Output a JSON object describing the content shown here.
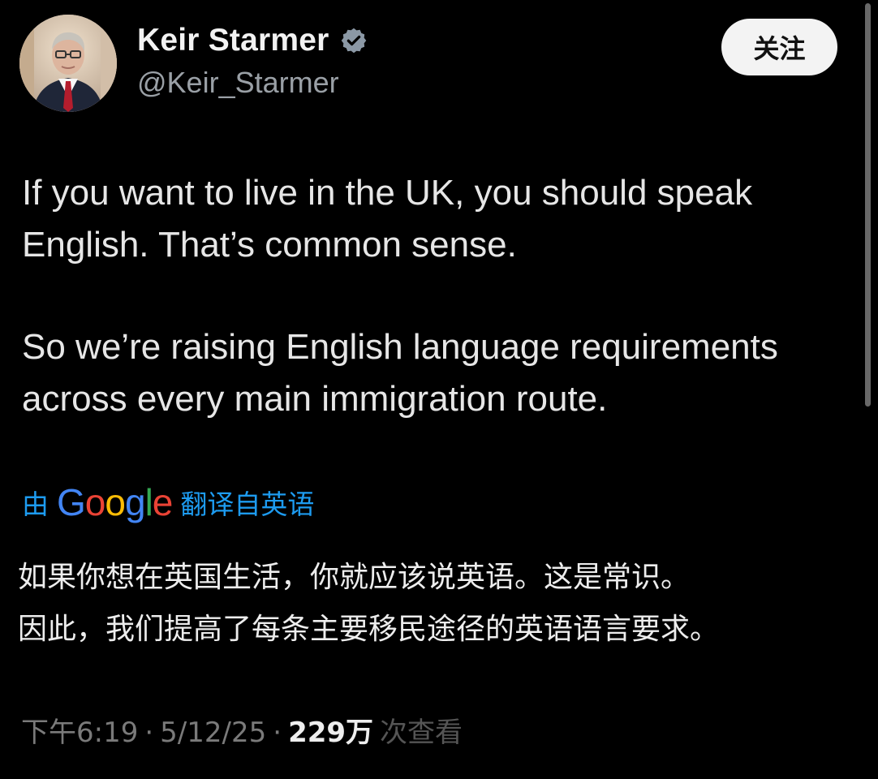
{
  "profile": {
    "display_name": "Keir Starmer",
    "handle": "@Keir_Starmer",
    "avatar_icon": "profile-photo",
    "verified_icon": "verified-badge-icon",
    "verified_color": "#8b98a5"
  },
  "actions": {
    "follow_label": "关注"
  },
  "tweet": {
    "paragraph1": "If you want to live in the UK, you should speak\nEnglish. That’s common sense.",
    "paragraph2": "So we’re raising English language requirements\nacross every main immigration route."
  },
  "translation": {
    "prefix": "由",
    "provider": "Google",
    "suffix": "翻译自英语",
    "line1": "如果你想在英国生活，你就应该说英语。这是常识。",
    "line2": "因此，我们提高了每条主要移民途径的英语语言要求。"
  },
  "meta": {
    "time": "下午6:19",
    "separator": "·",
    "date": "5/12/25",
    "views_count": "229万",
    "views_label": "次查看"
  },
  "colors": {
    "background": "#000000",
    "text": "#e7e9ea",
    "muted": "#9aa0a6",
    "link": "#1d9bf0",
    "button_bg": "#f3f3f3"
  }
}
